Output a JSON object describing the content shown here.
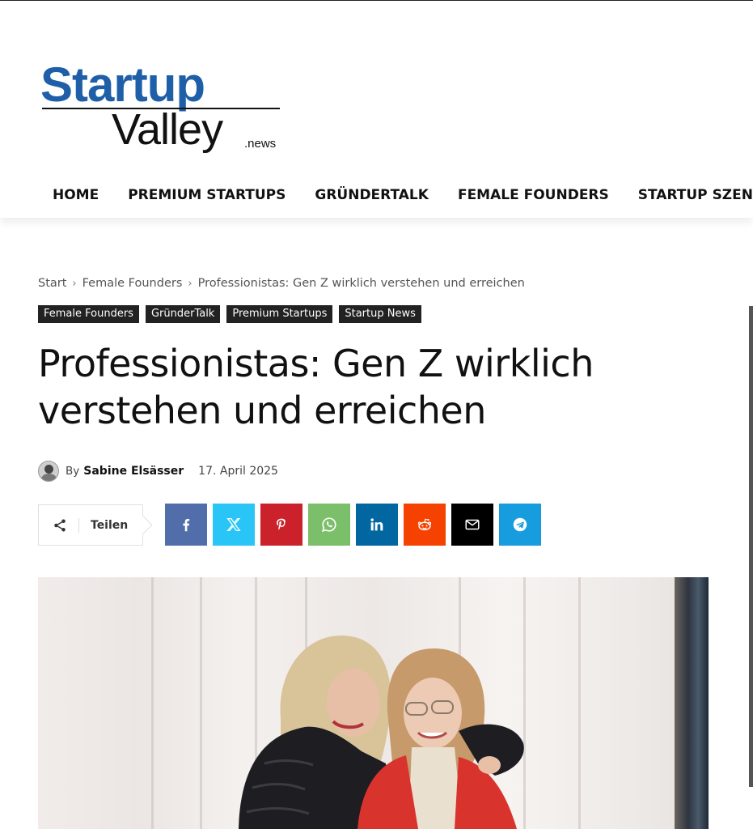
{
  "logo": {
    "line1": "Startup",
    "line2": "Valley",
    "suffix": ".news"
  },
  "nav": {
    "items": [
      {
        "label": "HOME"
      },
      {
        "label": "PREMIUM STARTUPS"
      },
      {
        "label": "GRÜNDERTALK"
      },
      {
        "label": "FEMALE FOUNDERS"
      },
      {
        "label": "STARTUP SZENE",
        "dropdown": true
      }
    ]
  },
  "breadcrumb": {
    "items": [
      "Start",
      "Female Founders",
      "Professionistas: Gen Z wirklich verstehen und erreichen"
    ],
    "separator": "›"
  },
  "categories": [
    "Female Founders",
    "GründerTalk",
    "Premium Startups",
    "Startup News"
  ],
  "article": {
    "title": "Professionistas: Gen Z wirklich verstehen und erreichen",
    "by": "By",
    "author": "Sabine Elsässer",
    "date": "17. April 2025"
  },
  "share": {
    "label": "Teilen",
    "buttons": [
      {
        "icon": "facebook-icon",
        "color": "#516eab"
      },
      {
        "icon": "x-twitter-icon",
        "color": "#29c5f6"
      },
      {
        "icon": "pinterest-icon",
        "color": "#ca212a"
      },
      {
        "icon": "whatsapp-icon",
        "color": "#7bbf6a"
      },
      {
        "icon": "linkedin-icon",
        "color": "#0266a0"
      },
      {
        "icon": "reddit-icon",
        "color": "#f54200"
      },
      {
        "icon": "email-icon",
        "color": "#000000"
      },
      {
        "icon": "telegram-icon",
        "color": "#179cde"
      }
    ]
  },
  "colors": {
    "brand_blue": "#1f5fa8",
    "tag_bg": "#222222"
  }
}
